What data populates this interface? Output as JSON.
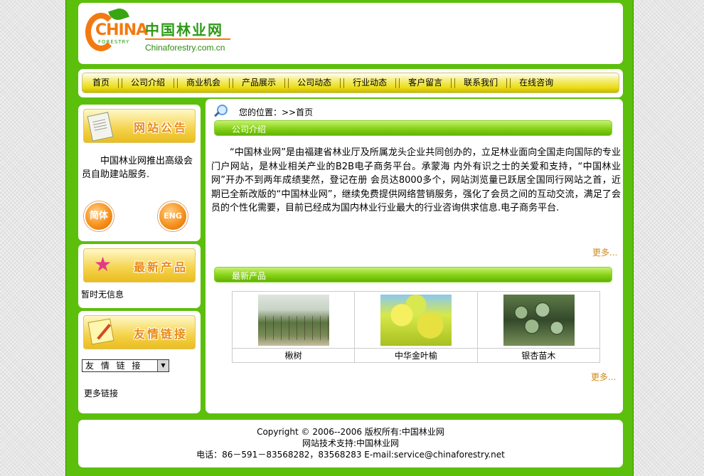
{
  "header": {
    "logo_china": "CHINA",
    "logo_forestry": "FORESTRY",
    "logo_cn": "中国林业网",
    "logo_en": "Chinaforestry.com.cn"
  },
  "nav": {
    "items": [
      "首页",
      "公司介绍",
      "商业机会",
      "产品展示",
      "公司动态",
      "行业动态",
      "客户留言",
      "联系我们",
      "在线咨询"
    ]
  },
  "sidebar": {
    "notice_title": "网站公告",
    "notice_text": "中国林业网推出高级会员自助建站服务.",
    "lang_simplified": "简体",
    "lang_english": "ENG",
    "products_title": "最新产品",
    "products_empty": "暂时无信息",
    "links_title": "友情链接",
    "links_select": "友 情 链 接",
    "more_links": "更多链接"
  },
  "main": {
    "location_label": "您的位置：>>首页",
    "about_title": "公司介绍",
    "about_text": "“中国林业网”是由福建省林业厅及所属龙头企业共同创办的，立足林业面向全国走向国际的专业门户网站，是林业相关产业的B2B电子商务平台。承蒙海 内外有识之士的关爱和支持，“中国林业网”开办不到两年成绩斐然，登记在册 会员达8000多个，网站浏览量已跃居全国同行网站之首，近期已全新改版的“中国林业网”，继续免费提供网络营销服务，强化了会员之间的互动交流，满足了会员的个性化需要，目前已经成为国内林业行业最大的行业咨询供求信息.电子商务平台.",
    "more": "更多...",
    "products_title": "最新产品",
    "products": [
      {
        "name": "楸树"
      },
      {
        "name": "中华金叶榆"
      },
      {
        "name": "银杏苗木"
      }
    ]
  },
  "footer": {
    "copyright": "Copyright © 2006--2006 版权所有:中国林业网",
    "support": "网站技术支持:中国林业网",
    "contact": "电话：86－591－83568282，83568283 E-mail:service@chinaforestry.net"
  }
}
